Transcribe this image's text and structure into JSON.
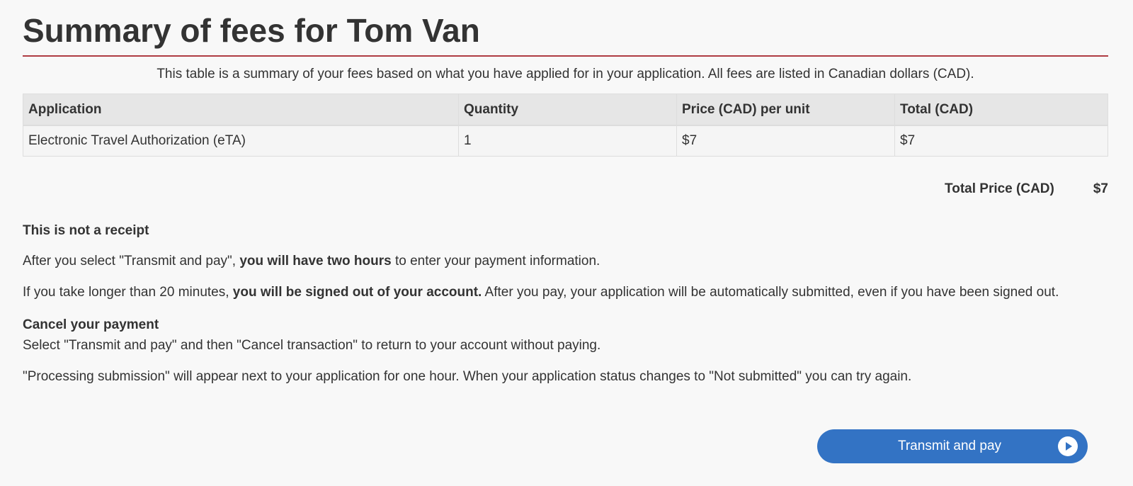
{
  "page": {
    "title": "Summary of fees for Tom Van",
    "intro": "This table is a summary of your fees based on what you have applied for in your application. All fees are listed in Canadian dollars (CAD)."
  },
  "fees_table": {
    "headers": [
      "Application",
      "Quantity",
      "Price (CAD) per unit",
      "Total (CAD)"
    ],
    "rows": [
      {
        "application": "Electronic Travel Authorization (eTA)",
        "quantity": "1",
        "price_per_unit": "$7",
        "total": "$7"
      }
    ]
  },
  "total": {
    "label": "Total Price (CAD)",
    "value": "$7"
  },
  "notice": {
    "heading": "This is not a receipt",
    "p1_before": "After you select \"Transmit and pay\", ",
    "p1_bold": "you will have two hours",
    "p1_after": " to enter your payment information.",
    "p2_before": "If you take longer than 20 minutes, ",
    "p2_bold": "you will be signed out of your account.",
    "p2_after": " After you pay, your application will be automatically submitted, even if you have been signed out.",
    "cancel_heading": "Cancel your payment",
    "p3": "Select \"Transmit and pay\" and then \"Cancel transaction\" to return to your account without paying.",
    "p4": "\"Processing submission\" will appear next to your application for one hour. When your application status changes to \"Not submitted\" you can try again."
  },
  "button": {
    "label": "Transmit and pay",
    "icon": "play-circle-icon"
  },
  "colors": {
    "title_rule": "#af3c43",
    "button": "#3373c4",
    "text": "#333333",
    "header_bg": "#e6e6e6"
  }
}
